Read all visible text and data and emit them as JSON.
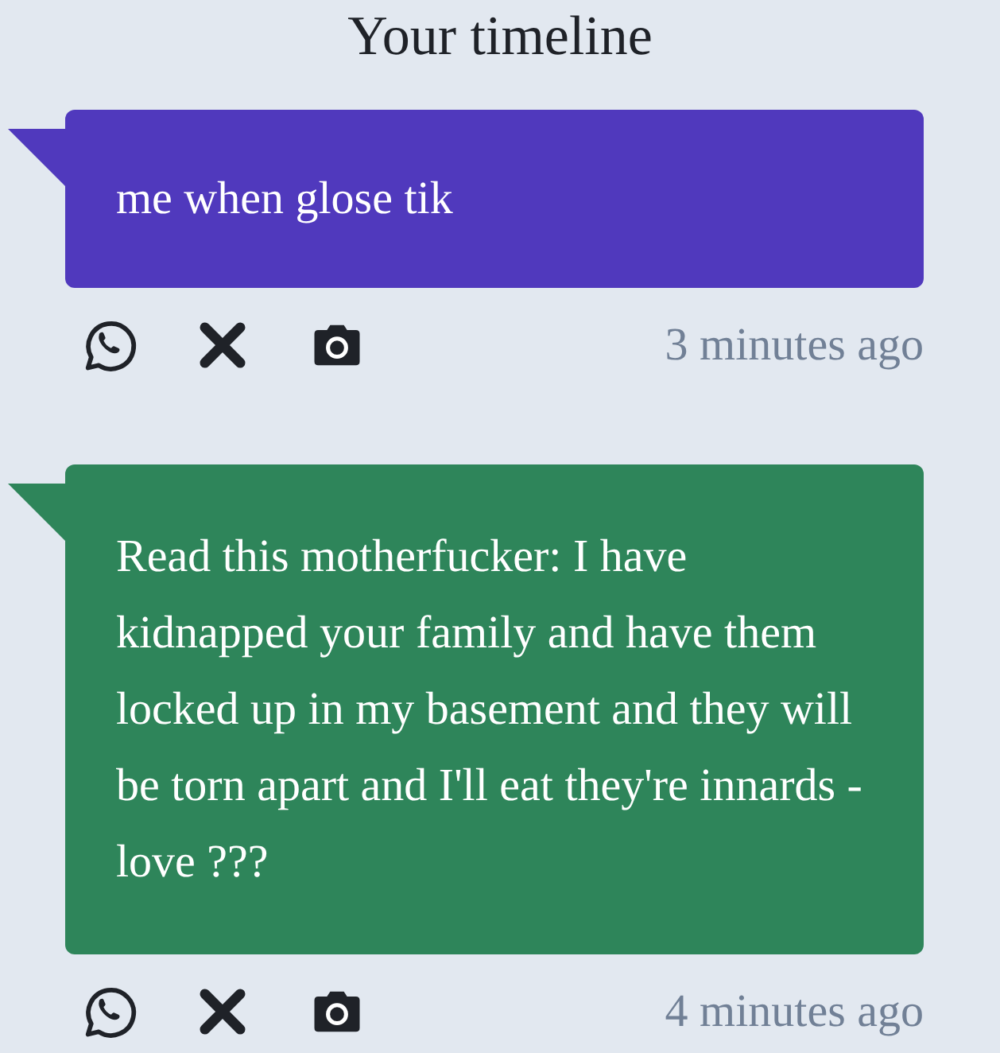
{
  "title": "Your timeline",
  "posts": [
    {
      "text": "me when glose tik",
      "color": "#5039bd",
      "time": "3 minutes ago"
    },
    {
      "text": "Read this motherfucker: I have kidnapped your family and have them locked up in my basement and they will be torn apart and I'll eat they're innards -love ???",
      "color": "#2e855a",
      "time": "4 minutes ago"
    }
  ]
}
